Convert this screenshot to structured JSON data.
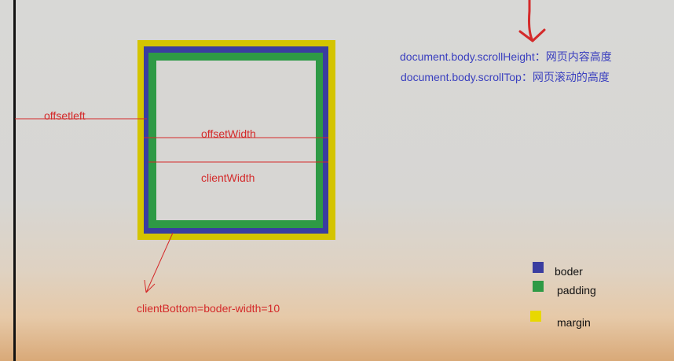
{
  "diagram": {
    "labels": {
      "offsetleft": "offsetleft",
      "offsetWidth": "offsetWidth",
      "clientWidth": "clientWidth",
      "clientBottom": "clientBottom=boder-width=10"
    },
    "notes": [
      "document.body.scrollHeight：网页内容高度",
      "document.body.scrollTop：网页滚动的高度"
    ],
    "legend": [
      {
        "label": "boder",
        "color": "#3a3da0"
      },
      {
        "label": "padding",
        "color": "#2e9a45"
      },
      {
        "label": "margin",
        "color": "#e8d800"
      }
    ]
  }
}
